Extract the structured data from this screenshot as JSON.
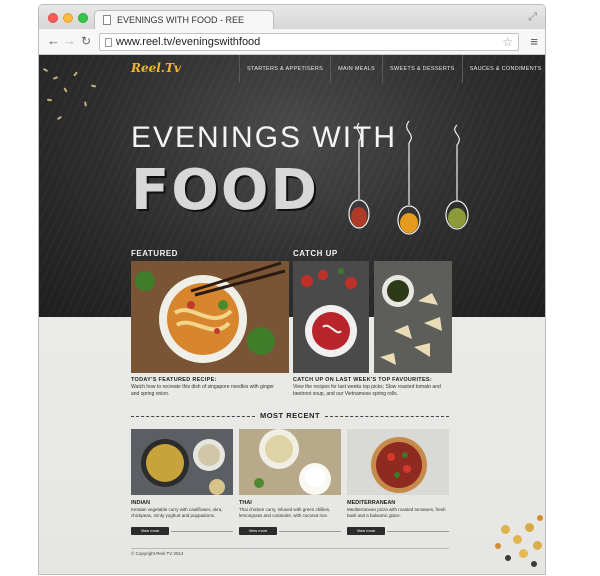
{
  "browser": {
    "tab_title": "EVENINGS WITH FOOD - REE",
    "url": "www.reel.tv/eveningswithfood"
  },
  "site": {
    "logo": "Reel.Tv",
    "nav": [
      "STARTERS & APPETISERS",
      "MAIN MEALS",
      "SWEETS & DESSERTS",
      "SAUCES & CONDIMENTS"
    ],
    "hero_line1": "EVENINGS WITH",
    "hero_line2": "FOOD"
  },
  "featured": {
    "label": "FEATURED",
    "heading": "TODAY'S FEATURED RECIPE:",
    "text": "Watch how to recreate this dish of singapore noodles with ginger and spring onion."
  },
  "catchup": {
    "label": "CATCH UP",
    "heading": "CATCH UP ON LAST WEEK'S TOP FAVOURITES:",
    "text": "View the recipes for last weeks top picks; Slow roasted tomato and beetroot soup, and our Vietnamese spring rolls."
  },
  "most_recent": {
    "label": "MOST RECENT",
    "items": [
      {
        "title": "INDIAN",
        "text": "Keralan vegetable curry with cauliflower, okra, chickpeas, minty yoghurt and poppadoms.",
        "button": "View more"
      },
      {
        "title": "THAI",
        "text": "Thai chicken curry, infused with green chillies, lemongrass and coriander, with coconut rice.",
        "button": "View more"
      },
      {
        "title": "MEDITERRANEAN",
        "text": "Mediterranean pizza with roasted tomatoes, fresh basil and a balsamic glaze.",
        "button": "View more"
      }
    ]
  },
  "footer": {
    "copyright": "© Copyright Reel TV 2014"
  },
  "colors": {
    "chalkboard": "#2d2d2d",
    "logo": "#f3b52b",
    "paper": "#ebebe8"
  }
}
